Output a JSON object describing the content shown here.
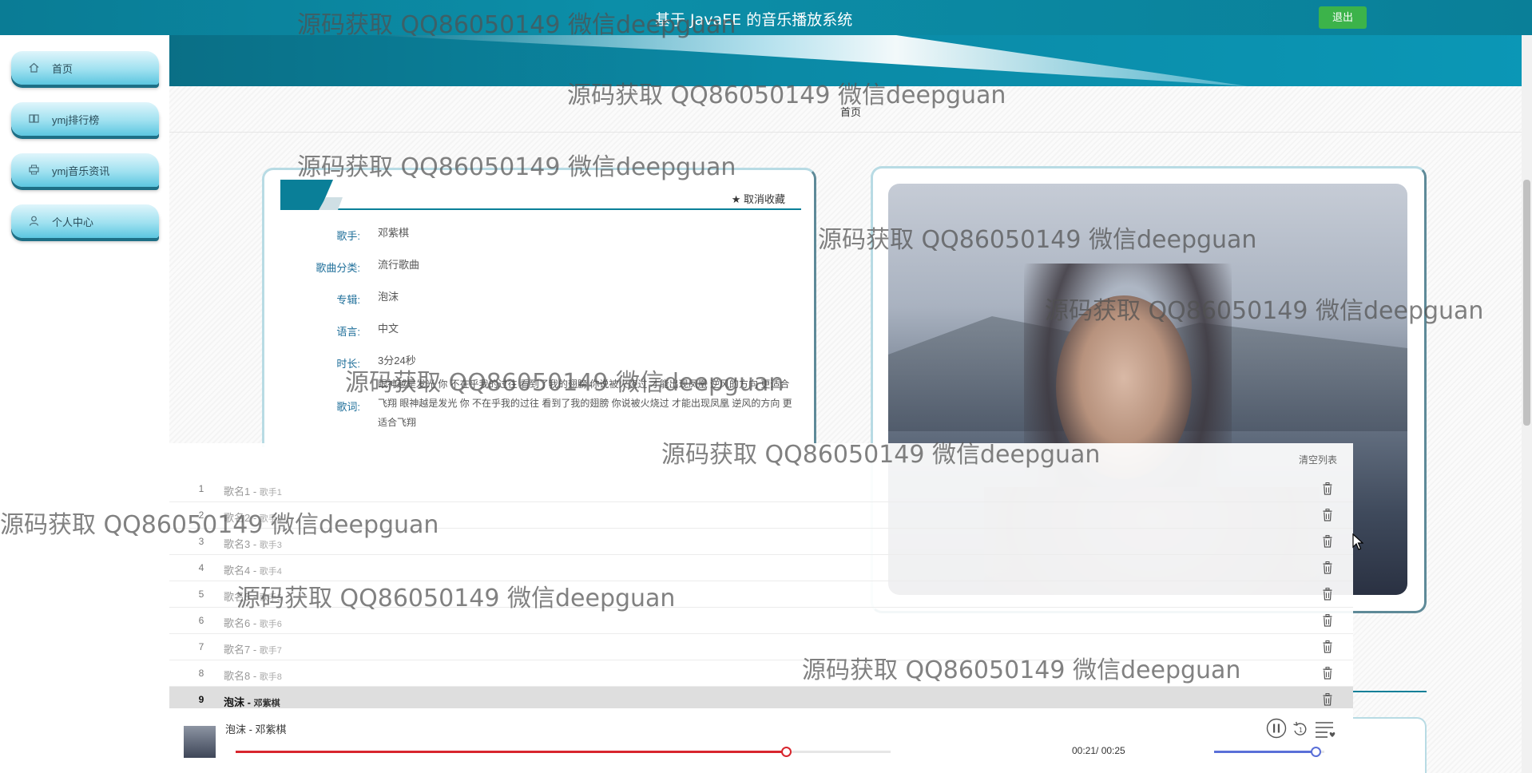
{
  "header": {
    "title": "基于 JavaEE 的音乐播放系统",
    "logout_label": "退出"
  },
  "sidebar": {
    "items": [
      {
        "label": "首页",
        "icon": "home-icon"
      },
      {
        "label": "ymj排行榜",
        "icon": "book-icon"
      },
      {
        "label": "ymj音乐资讯",
        "icon": "printer-icon"
      },
      {
        "label": "个人中心",
        "icon": "user-icon"
      }
    ]
  },
  "breadcrumb": "首页",
  "detail": {
    "favorite_label": "取消收藏",
    "fields": [
      {
        "key": "歌手:",
        "value": "邓紫棋"
      },
      {
        "key": "歌曲分类:",
        "value": "流行歌曲"
      },
      {
        "key": "专辑:",
        "value": "泡沫"
      },
      {
        "key": "语言:",
        "value": "中文"
      },
      {
        "key": "时长:",
        "value": "3分24秒"
      },
      {
        "key": "歌词:",
        "value": "眼神越是发光 你 不在乎我的过往 看到了我的翅膀 你说被火烧过 才能出现凤凰 逆风的方向 更适合飞翔 眼神越是发光 你 不在乎我的过往 看到了我的翅膀 你说被火烧过 才能出现凤凰 逆风的方向 更适合飞翔"
      }
    ]
  },
  "playlist": {
    "clear_label": "清空列表",
    "items": [
      {
        "n": "1",
        "song": "歌名1",
        "artist": "歌手1"
      },
      {
        "n": "2",
        "song": "歌名2",
        "artist": "歌手2"
      },
      {
        "n": "3",
        "song": "歌名3",
        "artist": "歌手3"
      },
      {
        "n": "4",
        "song": "歌名4",
        "artist": "歌手4"
      },
      {
        "n": "5",
        "song": "歌名5",
        "artist": "歌手5"
      },
      {
        "n": "6",
        "song": "歌名6",
        "artist": "歌手6"
      },
      {
        "n": "7",
        "song": "歌名7",
        "artist": "歌手7"
      },
      {
        "n": "8",
        "song": "歌名8",
        "artist": "歌手8"
      },
      {
        "n": "9",
        "song": "泡沫",
        "artist": "邓紫棋"
      }
    ],
    "active_index": 8
  },
  "player": {
    "now_playing": "泡沫 - 邓紫棋",
    "time": "00:21/ 00:25",
    "progress": 0.84,
    "volume": 0.92,
    "progress_color": "#d8262e",
    "volume_color": "#5a6fd8"
  },
  "watermarks": [
    "源码获取 QQ86050149 微信deepguan",
    "源码获取 QQ86050149 微信deepguan",
    "源码获取 QQ86050149 微信deepguan",
    "源码获取 QQ86050149 微信deepguan",
    "源码获取 QQ86050149 微信deepguan",
    "源码获取 QQ86050149 微信deepguan",
    "源码获取 QQ86050149 微信deepguan",
    "源码获取 QQ86050149 微信deepguan",
    "源码获取 QQ86050149 微信deepguan",
    "源码获取 QQ86050149 微信deepguan"
  ]
}
